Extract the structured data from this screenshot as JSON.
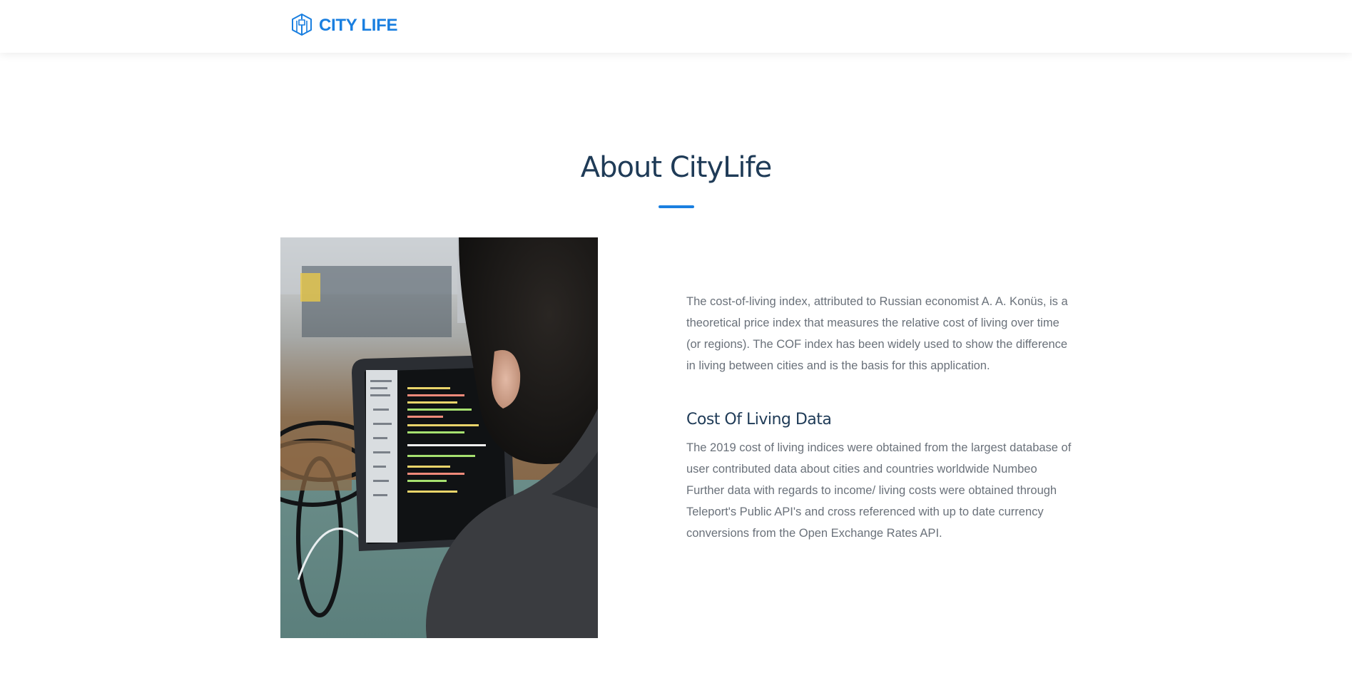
{
  "navbar": {
    "brand_text": "CITY LIFE",
    "brand_icon": "building-icon",
    "brand_color": "#1a7fe0"
  },
  "about": {
    "title": "About CityLife",
    "title_color": "#1f3b57",
    "accent_color": "#1a7fe0",
    "image_subject": "person-coding-at-laptop-photo",
    "intro_paragraph": "The cost-of-living index, attributed to Russian economist A. A. Konüs, is a theoretical price index that measures the relative cost of living over time (or regions). The COF index has been widely used to show the difference in living between cities and is the basis for this application.",
    "data_heading": "Cost Of Living Data",
    "data_paragraph": "The 2019 cost of living indices were obtained from the largest database of user contributed data about cities and countries worldwide Numbeo Further data with regards to income/ living costs were obtained through Teleport's Public API's and cross referenced with up to date currency conversions from the Open Exchange Rates API."
  }
}
